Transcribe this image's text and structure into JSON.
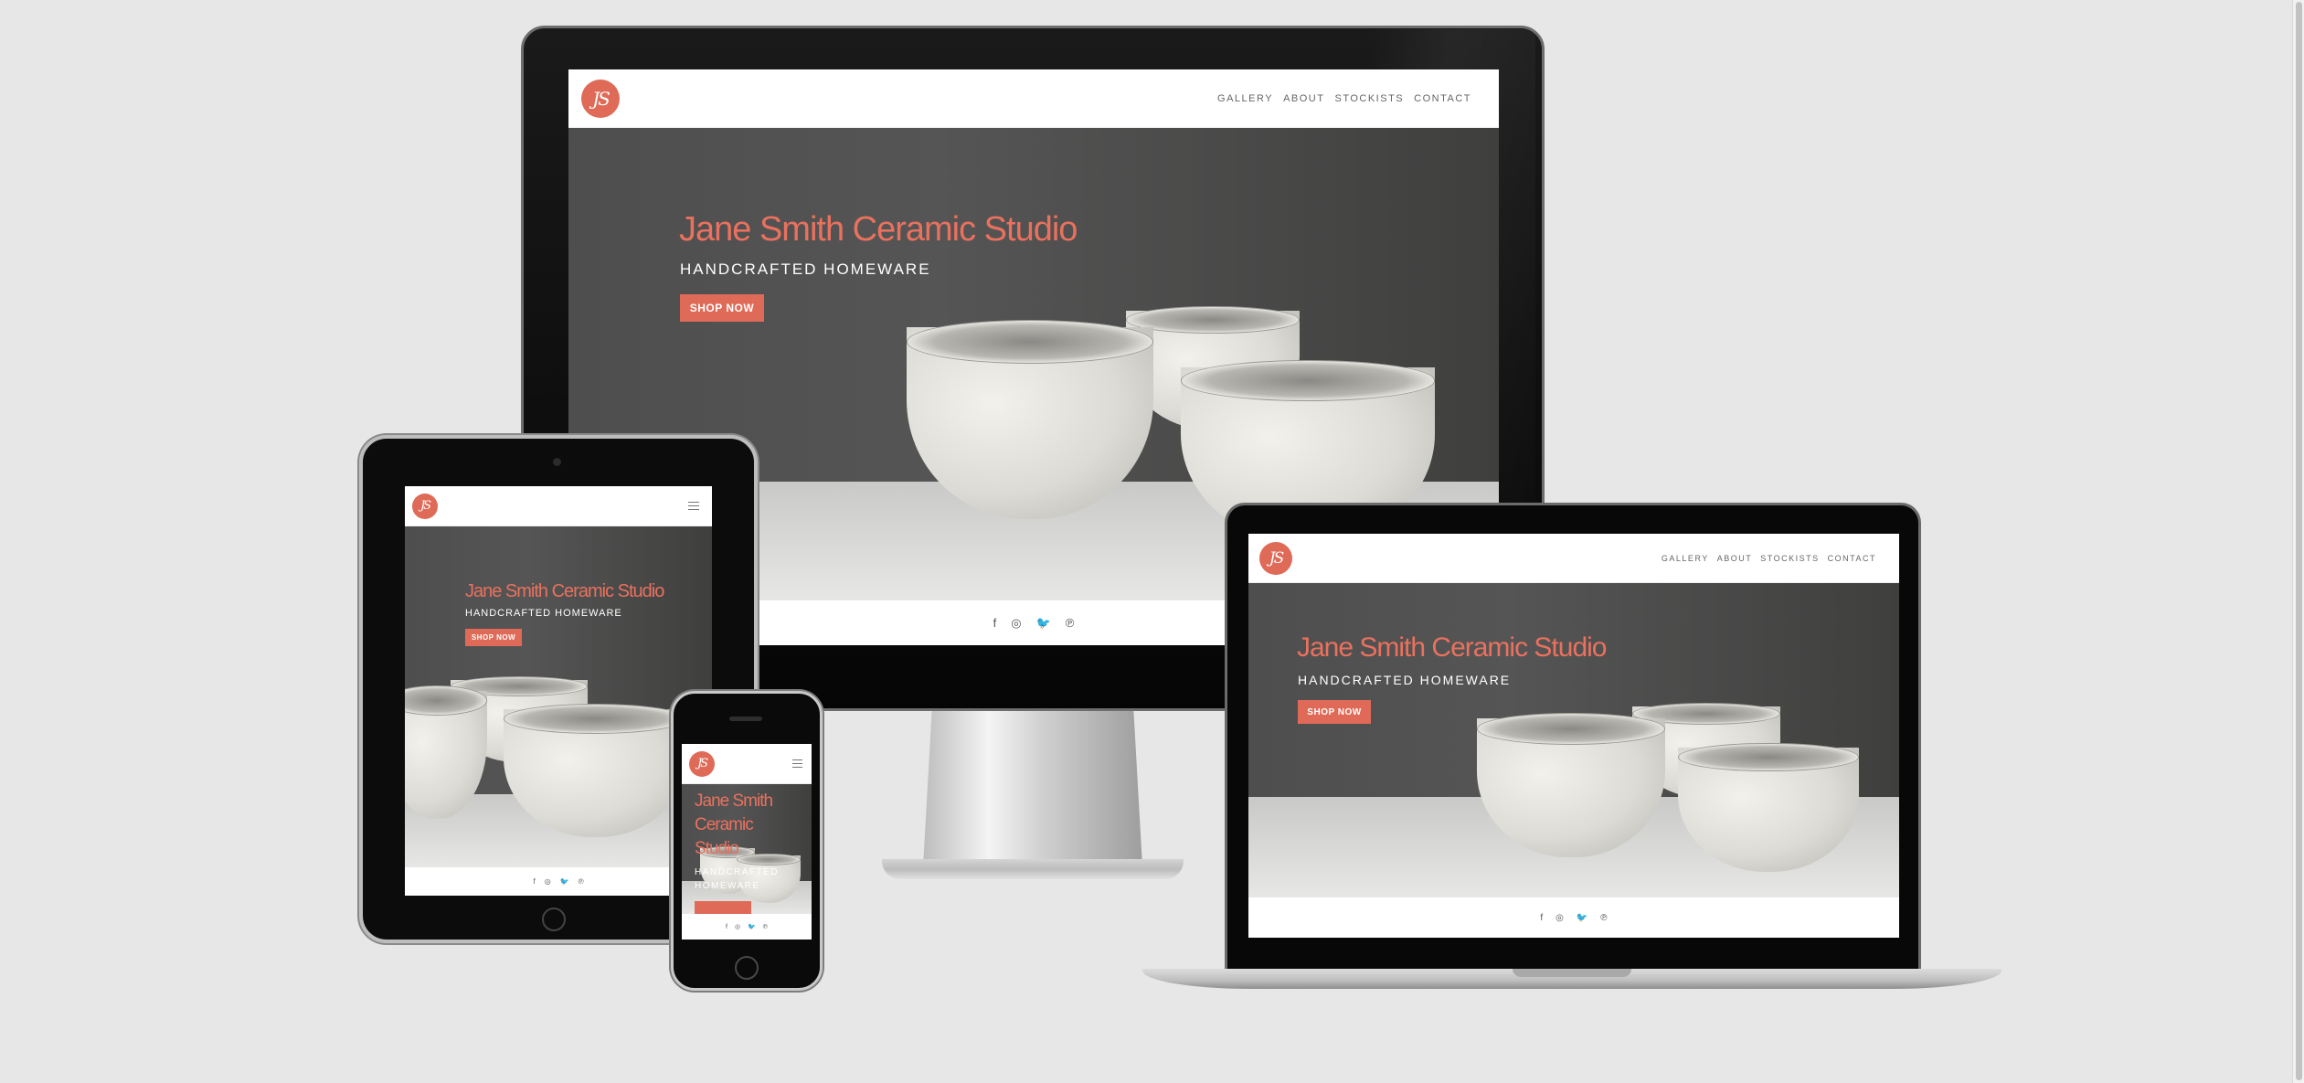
{
  "site": {
    "logo_text": "JS",
    "nav": [
      "GALLERY",
      "ABOUT",
      "STOCKISTS",
      "CONTACT"
    ],
    "hero_title": "Jane Smith Ceramic Studio",
    "hero_subtitle": "HANDCRAFTED HOMEWARE",
    "cta_label": "SHOP NOW",
    "social_icons": [
      "facebook-icon",
      "instagram-icon",
      "twitter-icon",
      "pinterest-icon"
    ],
    "social_glyphs": [
      "f",
      "◎",
      "🐦",
      "℗"
    ]
  },
  "colors": {
    "accent": "#e06a58",
    "background": "#e7e7e7",
    "hero_dark": "#4e4e4e",
    "device_bezel": "#0b0b0b"
  },
  "devices": [
    "desktop-monitor",
    "laptop",
    "tablet",
    "phone"
  ]
}
